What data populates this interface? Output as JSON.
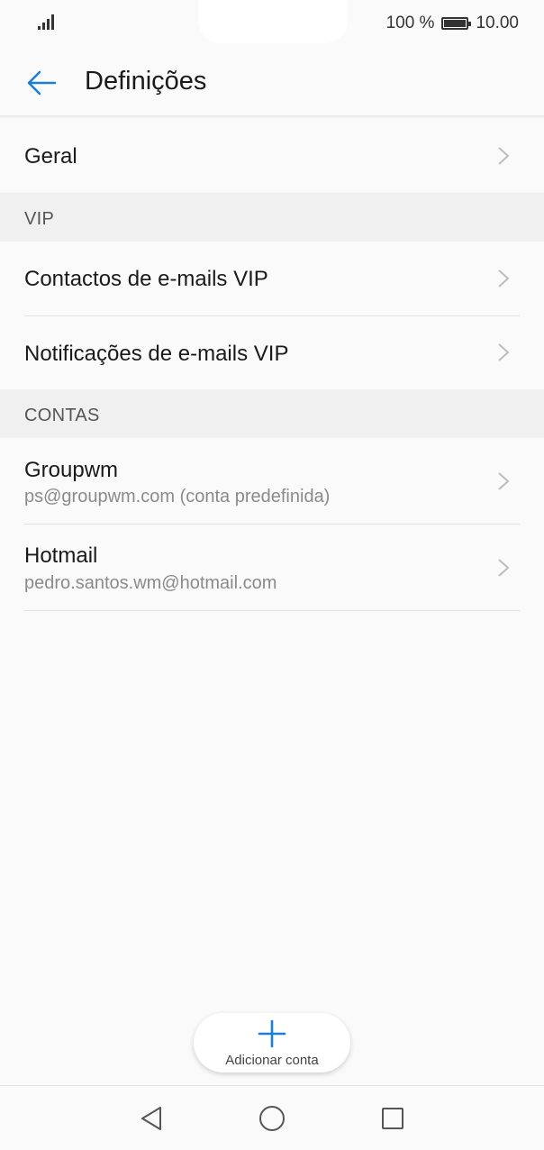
{
  "status": {
    "battery_text": "100 %",
    "time": "10.00"
  },
  "header": {
    "title": "Definições"
  },
  "rows": {
    "general": {
      "label": "Geral"
    },
    "vip_contacts": {
      "label": "Contactos de e-mails VIP"
    },
    "vip_notifications": {
      "label": "Notificações de e-mails VIP"
    }
  },
  "sections": {
    "vip": "VIP",
    "accounts": "CONTAS"
  },
  "accounts": [
    {
      "name": "Groupwm",
      "email": "ps@groupwm.com (conta predefinida)"
    },
    {
      "name": "Hotmail",
      "email": "pedro.santos.wm@hotmail.com"
    }
  ],
  "fab": {
    "label": "Adicionar conta"
  },
  "colors": {
    "accent": "#1a7fd6",
    "background": "#fafafa",
    "section_background": "#f0f0f0"
  }
}
